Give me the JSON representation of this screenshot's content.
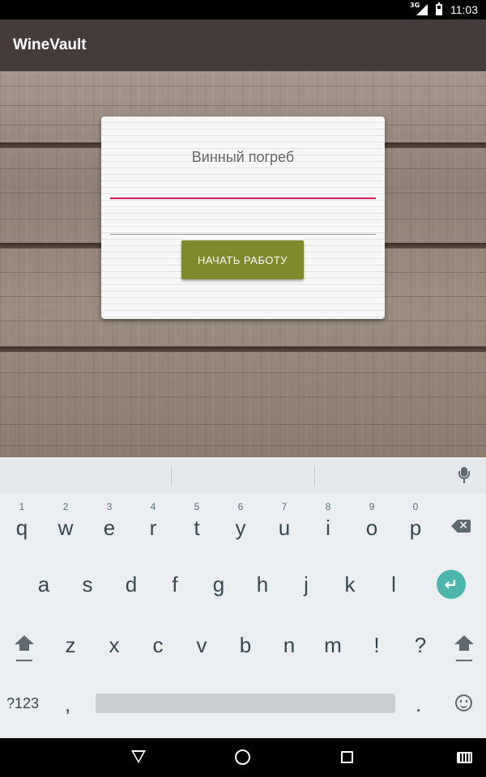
{
  "status_bar": {
    "network": "3G",
    "time": "11:03"
  },
  "app_bar": {
    "title": "WineVault"
  },
  "card": {
    "title": "Винный погреб",
    "field_1": {
      "value": "",
      "placeholder": ""
    },
    "field_2": {
      "value": "",
      "placeholder": ""
    },
    "start_button_label": "НАЧАТЬ РАБОТУ",
    "accent_color": "#d81b60",
    "button_color": "#7f8a2d"
  },
  "keyboard": {
    "row1": [
      {
        "key": "q",
        "hint": "1"
      },
      {
        "key": "w",
        "hint": "2"
      },
      {
        "key": "e",
        "hint": "3"
      },
      {
        "key": "r",
        "hint": "4"
      },
      {
        "key": "t",
        "hint": "5"
      },
      {
        "key": "y",
        "hint": "6"
      },
      {
        "key": "u",
        "hint": "7"
      },
      {
        "key": "i",
        "hint": "8"
      },
      {
        "key": "o",
        "hint": "9"
      },
      {
        "key": "p",
        "hint": "0"
      }
    ],
    "row2": [
      "a",
      "s",
      "d",
      "f",
      "g",
      "h",
      "j",
      "k",
      "l"
    ],
    "row3": [
      "z",
      "x",
      "c",
      "v",
      "b",
      "n",
      "m",
      "!",
      "?"
    ],
    "symbols_label": "?123",
    "comma_label": ",",
    "period_label": ".",
    "enter_color": "#4db6ac"
  },
  "nav_bar": {
    "icons": [
      "back-icon",
      "home-icon",
      "recents-icon",
      "keyboard-switch-icon"
    ]
  }
}
